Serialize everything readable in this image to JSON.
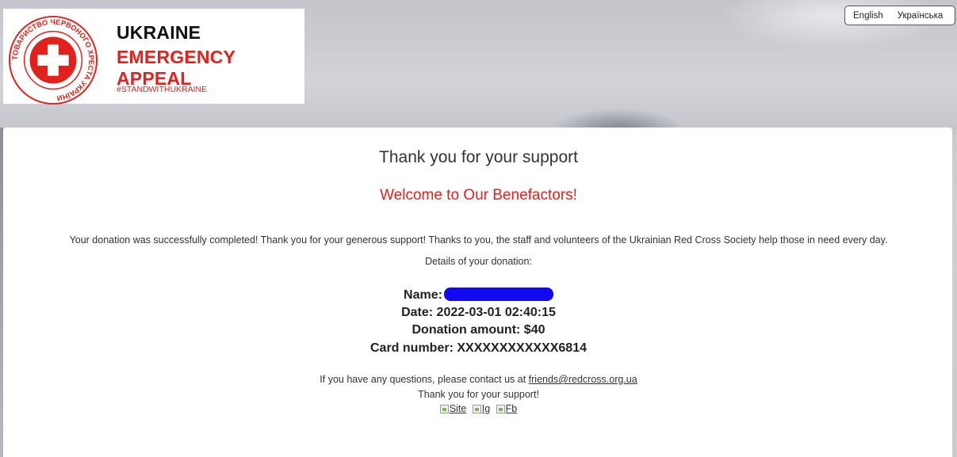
{
  "header": {
    "logo": {
      "seal_text": "ТОВАРИСТВО ЧЕРВОНОГО ХРЕСТА УКРАЇНИ",
      "title": "UKRAINE",
      "subtitle": "EMERGENCY APPEAL",
      "hashtag": "#STANDWITHUKRAINE",
      "brand_color": "#e2211c"
    },
    "languages": [
      "English",
      "Українська"
    ]
  },
  "main": {
    "heading": "Thank you for your support",
    "welcome": "Welcome to Our Benefactors!",
    "message": "Your donation was successfully completed! Thank you for your generous support! Thanks to you, the staff and volunteers of the Ukrainian Red Cross Society help those in need every day.",
    "details_label": "Details of your donation:",
    "details": {
      "name_label": "Name:",
      "date": "Date: 2022-03-01 02:40:15",
      "amount": "Donation amount: $40",
      "card": "Card number: XXXXXXXXXXXX6814"
    },
    "contact_prefix": "If you have any questions, please contact us at ",
    "contact_email": "friends@redcross.org.ua",
    "closing": "Thank you for your support!",
    "social_links": [
      "Site",
      "Ig",
      "Fb"
    ]
  }
}
